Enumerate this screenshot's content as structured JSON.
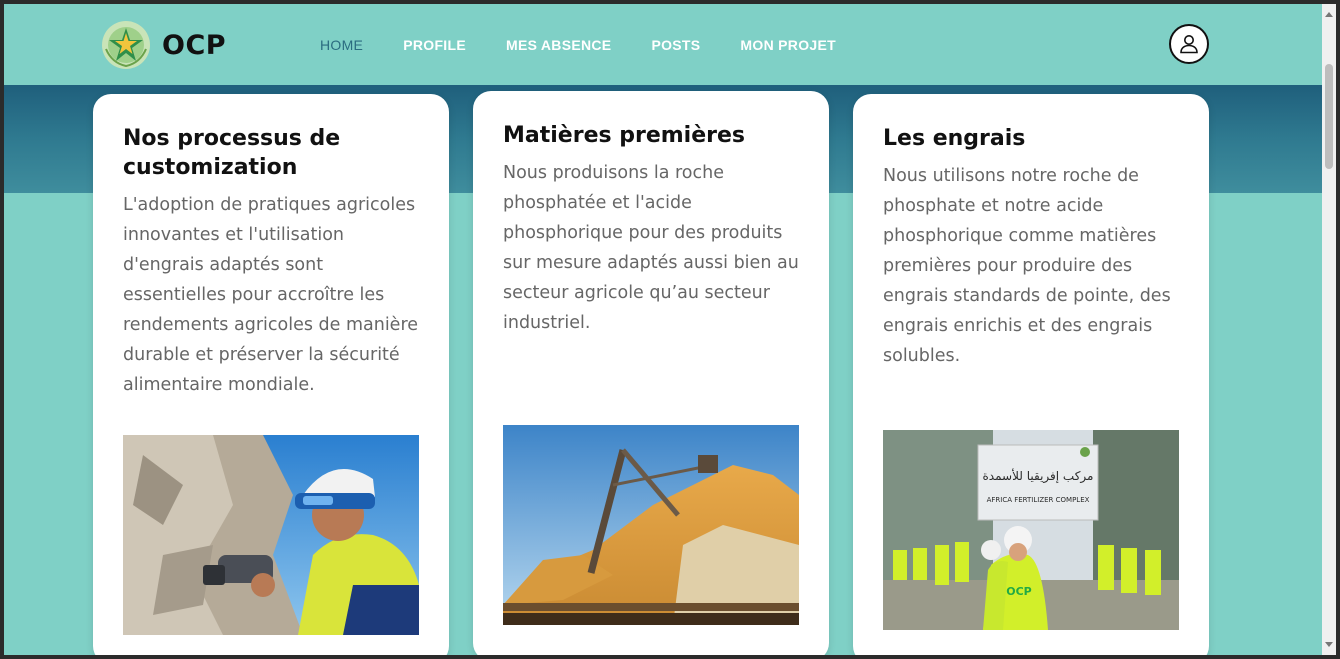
{
  "header": {
    "brand": "OCP",
    "nav": [
      {
        "label": "HOME",
        "active": true
      },
      {
        "label": "PROFILE",
        "active": false
      },
      {
        "label": "MES ABSENCE",
        "active": false
      },
      {
        "label": "POSTS",
        "active": false
      },
      {
        "label": "MON PROJET",
        "active": false
      }
    ],
    "avatar_icon": "user-icon"
  },
  "colors": {
    "background": "#7fd0c6",
    "nav_active": "#2b6c80",
    "banner": "#2f7a90"
  },
  "cards": [
    {
      "title": "Nos processus de customization",
      "text": "L'adoption de pratiques agricoles innovantes et l'utilisation d'engrais adaptés sont essentielles pour accroître les rendements agricoles de manière durable et préserver la sécurité alimentaire mondiale.",
      "image": "worker-with-analyzer"
    },
    {
      "title": "Matières premières",
      "text": "Nous produisons la roche phosphatée et l'acide phosphorique pour des produits sur mesure adaptés aussi bien au secteur agricole qu’au secteur industriel.",
      "image": "phosphate-stockpile"
    },
    {
      "title": "Les engrais",
      "text": "Nous utilisons notre roche de phosphate et notre acide phosphorique comme matières premières pour produire des engrais standards de pointe, des engrais enrichis et des engrais solubles.",
      "image": "fertilizer-complex-visit",
      "image_sign_ar": "مركب إفريقيا للأسمدة",
      "image_sign_en": "AFRICA FERTILIZER COMPLEX",
      "image_vest_text": "OCP"
    }
  ]
}
